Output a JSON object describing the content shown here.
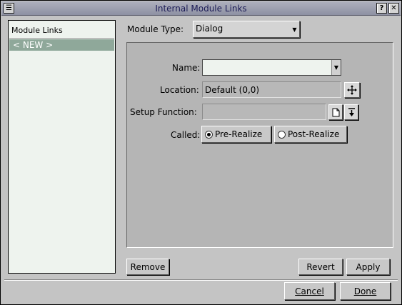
{
  "window": {
    "title": "Internal Module Links"
  },
  "titlebar": {
    "menu_glyph": "☰",
    "help_glyph": "?",
    "close_glyph": "✕"
  },
  "list": {
    "header": "Module Links",
    "items": [
      {
        "label": "< NEW >",
        "selected": true
      }
    ]
  },
  "module_type": {
    "label": "Module Type:",
    "value": "Dialog"
  },
  "form": {
    "name": {
      "label": "Name:",
      "value": ""
    },
    "location": {
      "label": "Location:",
      "value": "Default (0,0)"
    },
    "setup": {
      "label": "Setup Function:",
      "value": ""
    },
    "called": {
      "label": "Called:",
      "options": [
        {
          "label": "Pre-Realize",
          "checked": true
        },
        {
          "label": "Post-Realize",
          "checked": false
        }
      ]
    }
  },
  "buttons": {
    "remove": "Remove",
    "revert": "Revert",
    "apply": "Apply",
    "cancel": "Cancel",
    "done": "Done"
  },
  "colors": {
    "list_bg": "#eef3ee",
    "selected_bg": "#8fa89a",
    "window_bg": "#c4c4c4"
  }
}
